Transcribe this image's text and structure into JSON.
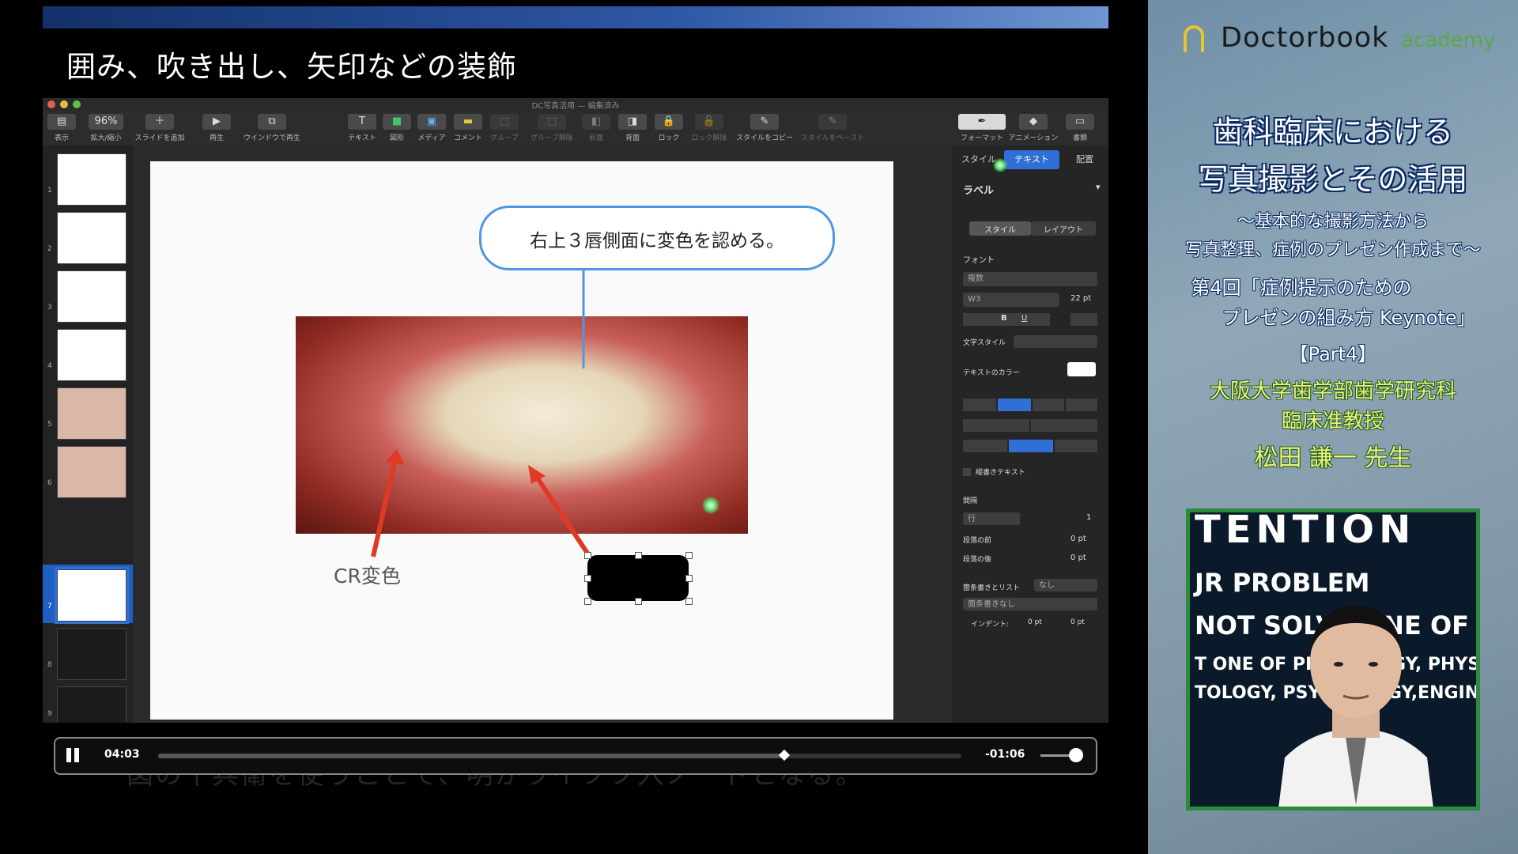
{
  "heading": "囲み、吹き出し、矢印などの装飾",
  "keynote": {
    "window_title": "DC写真活用 — 編集済み",
    "toolbar": [
      {
        "icon": "view-icon",
        "label": "表示"
      },
      {
        "icon": "zoom-icon",
        "label": "拡大/縮小",
        "value": "96%"
      },
      {
        "icon": "add-slide-icon",
        "label": "スライドを追加"
      },
      {
        "icon": "play-icon",
        "label": "再生"
      },
      {
        "icon": "play-window-icon",
        "label": "ウインドウで再生"
      },
      {
        "icon": "text-icon",
        "label": "テキスト"
      },
      {
        "icon": "shape-icon",
        "label": "図形"
      },
      {
        "icon": "media-icon",
        "label": "メディア"
      },
      {
        "icon": "comment-icon",
        "label": "コメント"
      },
      {
        "icon": "group-icon",
        "label": "グループ"
      },
      {
        "icon": "ungroup-icon",
        "label": "グループ解除"
      },
      {
        "icon": "front-icon",
        "label": "前面"
      },
      {
        "icon": "back-icon",
        "label": "背面"
      },
      {
        "icon": "lock-icon",
        "label": "ロック"
      },
      {
        "icon": "unlock-icon",
        "label": "ロック解除"
      },
      {
        "icon": "copy-style-icon",
        "label": "スタイルをコピー"
      },
      {
        "icon": "paste-style-icon",
        "label": "スタイルをペースト"
      },
      {
        "icon": "format-icon",
        "label": "フォーマット"
      },
      {
        "icon": "animate-icon",
        "label": "アニメーション"
      },
      {
        "icon": "document-icon",
        "label": "書類"
      }
    ],
    "slide_numbers": [
      "1",
      "2",
      "3",
      "4",
      "5",
      "6",
      "7",
      "8",
      "9"
    ],
    "selected_slide": 7,
    "slide": {
      "callout_text": "右上３唇側面に変色を認める。",
      "label_text": "CR変色"
    },
    "inspector": {
      "tabs": [
        "スタイル",
        "テキスト",
        "配置"
      ],
      "active_tab": "テキスト",
      "paragraph_style": "ラベル",
      "subtabs": [
        "スタイル",
        "レイアウト"
      ],
      "font_heading": "フォント",
      "font_family": "複数",
      "font_weight": "W3",
      "font_size": "22 pt",
      "char_style_label": "文字スタイル",
      "text_color_label": "テキストのカラー",
      "vertical_text_label": "縦書きテキスト",
      "spacing_heading": "間隔",
      "spacing_mode": "行",
      "spacing_value": "1",
      "space_before_label": "段落の前",
      "space_before": "0 pt",
      "space_after_label": "段落の後",
      "space_after": "0 pt",
      "bullets_label": "箇条書きとリスト",
      "bullets_value": "なし",
      "bullets_style": "箇条書きなし",
      "indent_label": "インデント:",
      "indent_1": "0 pt",
      "indent_2": "0 pt"
    }
  },
  "player": {
    "current_time": "04:03",
    "remaining_time": "-01:06",
    "progress": 0.78
  },
  "subtitle_ghost": "図の十兵衛を使うことで、明かライフフ入ノードとなる。",
  "side": {
    "logo": "Doctorbook",
    "logo_sub": "academy",
    "title_line1": "歯科臨床における",
    "title_line2": "写真撮影とその活用",
    "subtitle_line1": "〜基本的な撮影方法から",
    "subtitle_line2": "写真整理、症例のプレゼン作成まで〜",
    "episode_line1": "第4回「症例提示のための",
    "episode_line2": "プレゼンの組み方 Keynote」",
    "part": "【Part4】",
    "affiliation_line1": "大阪大学歯学部歯学研究科",
    "affiliation_line2": "臨床准教授",
    "speaker": "松田 謙一 先生",
    "webcam_text": [
      "TENTION",
      "JR PROBLEM",
      "NOT SOLVE ONE OF N",
      "T ONE OF PHYSIOLOGY, PHYSIO",
      "TOLOGY, PSYCHOLOGY,ENGINEER"
    ]
  }
}
